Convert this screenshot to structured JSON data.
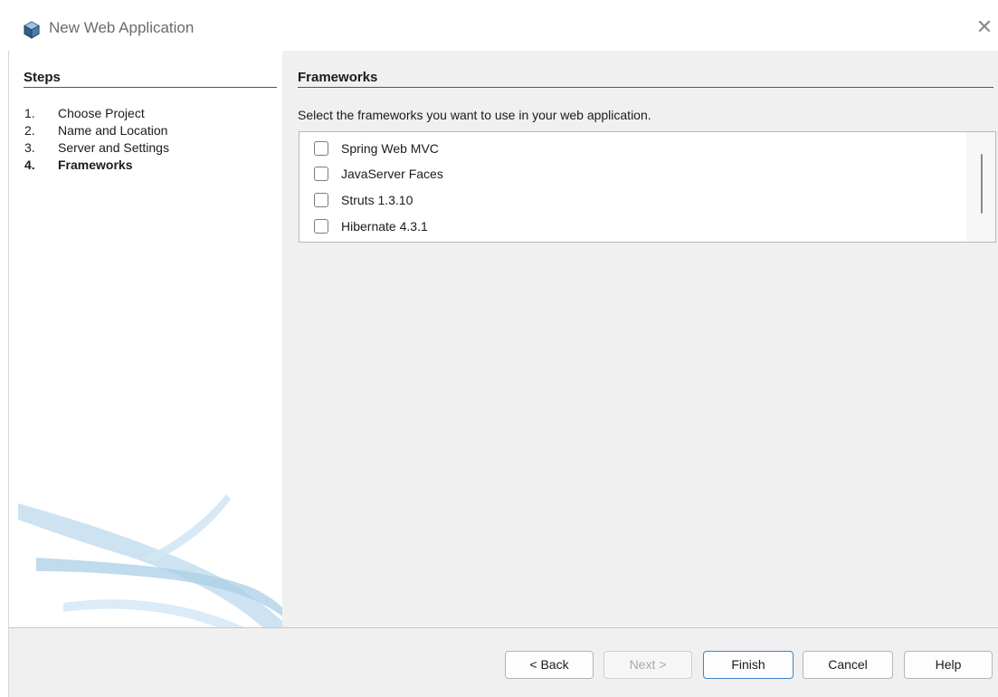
{
  "window": {
    "title": "New Web Application",
    "close_icon": "close-icon",
    "app_icon": "netbeans-cube-icon"
  },
  "steps": {
    "heading": "Steps",
    "items": [
      {
        "num": "1.",
        "label": "Choose Project",
        "current": false
      },
      {
        "num": "2.",
        "label": "Name and Location",
        "current": false
      },
      {
        "num": "3.",
        "label": "Server and Settings",
        "current": false
      },
      {
        "num": "4.",
        "label": "Frameworks",
        "current": true
      }
    ]
  },
  "frameworks": {
    "heading": "Frameworks",
    "description": "Select the frameworks you want to use in your web application.",
    "items": [
      {
        "label": "Spring Web MVC",
        "checked": false
      },
      {
        "label": "JavaServer Faces",
        "checked": false
      },
      {
        "label": "Struts 1.3.10",
        "checked": false
      },
      {
        "label": "Hibernate 4.3.1",
        "checked": false
      }
    ]
  },
  "buttons": {
    "back": "< Back",
    "next": "Next >",
    "finish": "Finish",
    "cancel": "Cancel",
    "help": "Help"
  },
  "colors": {
    "panel_bg": "#f0f0f0",
    "primary_border": "#3d85c6",
    "swoosh": "#b9d7e8"
  }
}
